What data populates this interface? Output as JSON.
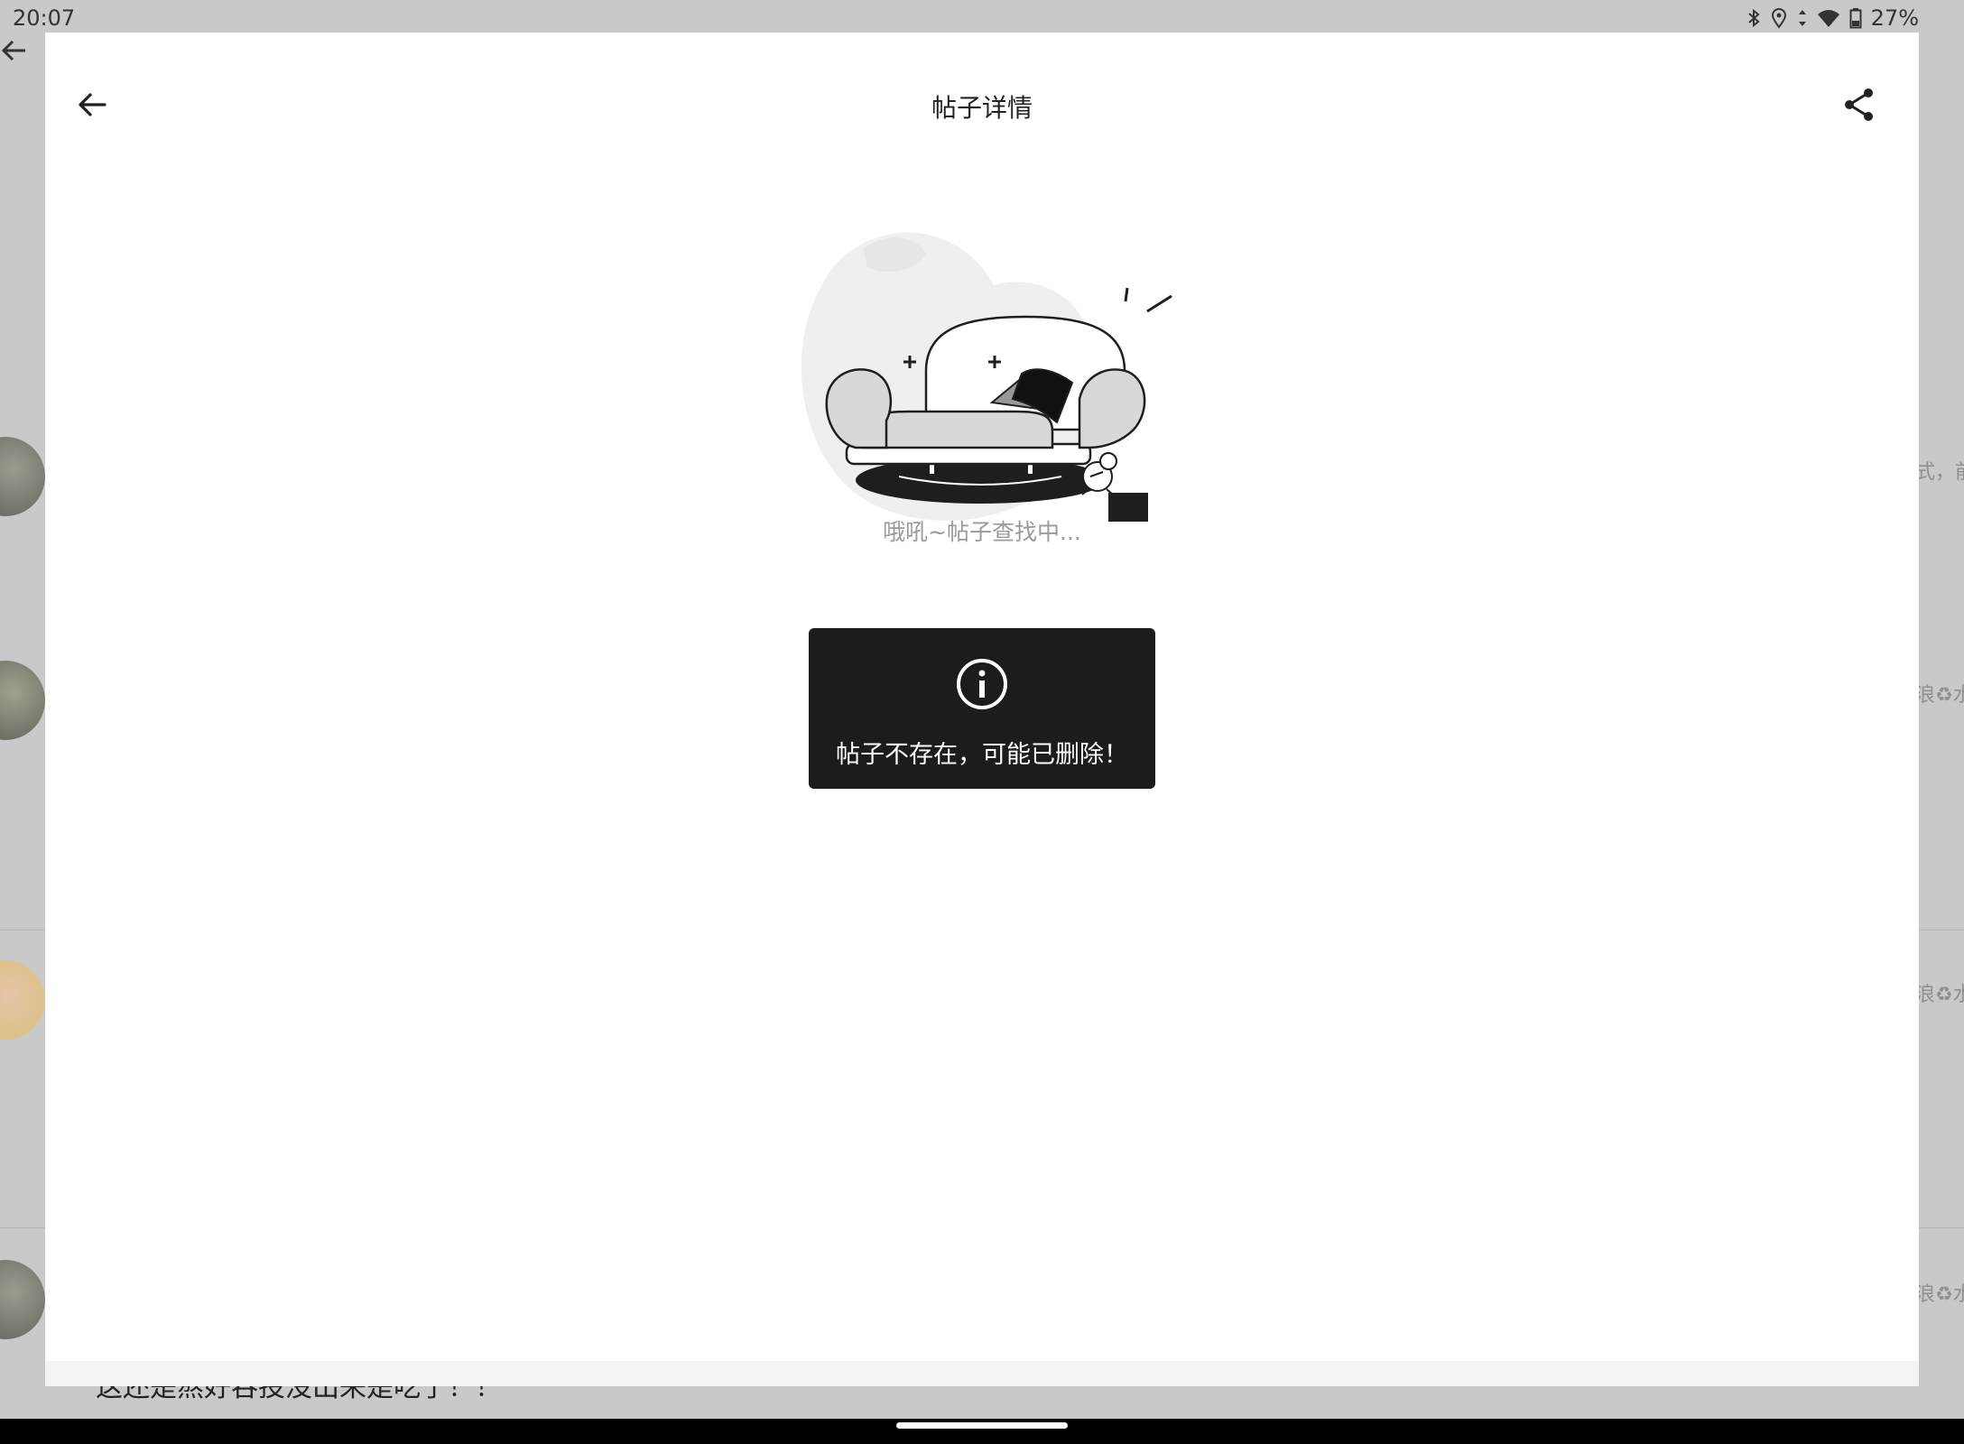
{
  "status": {
    "time": "20:07",
    "battery_percent": "27%",
    "icons": [
      "bluetooth-icon",
      "location-icon",
      "data-arrows-icon",
      "wifi-icon",
      "battery-icon"
    ]
  },
  "background": {
    "side_texts": [
      "式，前",
      "浪♻水",
      "浪♻水",
      "浪♻水"
    ],
    "bottom_text": "这还是熬好吞投没出来是吃了！！"
  },
  "header": {
    "title": "帖子详情",
    "back_icon": "arrow-left-icon",
    "share_icon": "share-icon"
  },
  "empty_state": {
    "illustration": "sofa-illustration",
    "text": "哦吼~帖子查找中..."
  },
  "toast": {
    "icon": "info-icon",
    "message": "帖子不存在，可能已删除！"
  },
  "colors": {
    "overlay": "#c9c9c9",
    "modal": "#ffffff",
    "toast_bg": "#1c1c1c",
    "muted_text": "#9a9a9a"
  }
}
